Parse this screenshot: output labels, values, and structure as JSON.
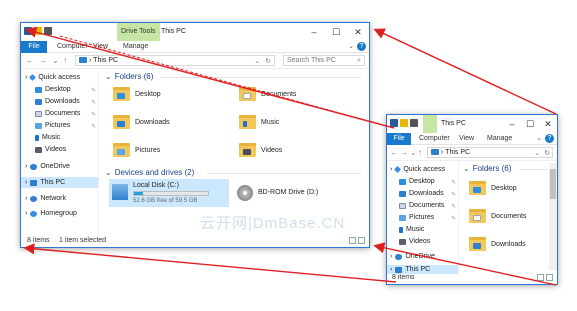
{
  "big": {
    "title": "This PC",
    "context_tab": "Drive Tools",
    "ribbon_tabs": [
      "File",
      "Computer",
      "View",
      "Manage"
    ],
    "window_controls": [
      "–",
      "☐",
      "✕"
    ],
    "help": "?",
    "expand": "⌄",
    "address": "This PC",
    "search_placeholder": "Search This PC",
    "sidebar": [
      {
        "label": "Quick access",
        "icon": "star-icon"
      },
      {
        "label": "Desktop",
        "icon": "desktop-icon"
      },
      {
        "label": "Downloads",
        "icon": "download-icon"
      },
      {
        "label": "Documents",
        "icon": "document-icon"
      },
      {
        "label": "Pictures",
        "icon": "pictures-icon"
      },
      {
        "label": "Music",
        "icon": "music-icon"
      },
      {
        "label": "Videos",
        "icon": "videos-icon"
      },
      {
        "label": "OneDrive",
        "icon": "cloud-icon"
      },
      {
        "label": "This PC",
        "icon": "pc-icon"
      },
      {
        "label": "Network",
        "icon": "network-icon"
      },
      {
        "label": "Homegroup",
        "icon": "homegroup-icon"
      }
    ],
    "folders_header": "Folders (6)",
    "folders": [
      "Desktop",
      "Documents",
      "Downloads",
      "Music",
      "Pictures",
      "Videos"
    ],
    "drives_header": "Devices and drives (2)",
    "drive_c": {
      "name": "Local Disk (C:)",
      "free": "52.6 GB free of 59.5 GB",
      "used_fraction": 0.12
    },
    "drive_d": {
      "name": "BD-ROM Drive (D:)"
    },
    "status_items": "8 items",
    "status_selected": "1 item selected"
  },
  "small": {
    "title": "This PC",
    "ribbon_tabs": [
      "File",
      "Computer",
      "View",
      "Manage"
    ],
    "window_controls": [
      "–",
      "☐",
      "✕"
    ],
    "help": "?",
    "expand": "⌄",
    "address": "This PC",
    "sidebar": [
      {
        "label": "Quick access",
        "icon": "star-icon"
      },
      {
        "label": "Desktop",
        "icon": "desktop-icon"
      },
      {
        "label": "Downloads",
        "icon": "download-icon"
      },
      {
        "label": "Documents",
        "icon": "document-icon"
      },
      {
        "label": "Pictures",
        "icon": "pictures-icon"
      },
      {
        "label": "Music",
        "icon": "music-icon"
      },
      {
        "label": "Videos",
        "icon": "videos-icon"
      },
      {
        "label": "OneDrive",
        "icon": "cloud-icon"
      },
      {
        "label": "This PC",
        "icon": "pc-icon"
      }
    ],
    "folders_header": "Folders (6)",
    "folders": [
      "Desktop",
      "Documents",
      "Downloads"
    ],
    "status_items": "8 items"
  },
  "watermark": "云开网|DmBase.CN",
  "colors": {
    "accent": "#1979ca",
    "selection": "#cce8ff",
    "arrow": "#e02020",
    "context_tab": "#c7e6a4"
  }
}
